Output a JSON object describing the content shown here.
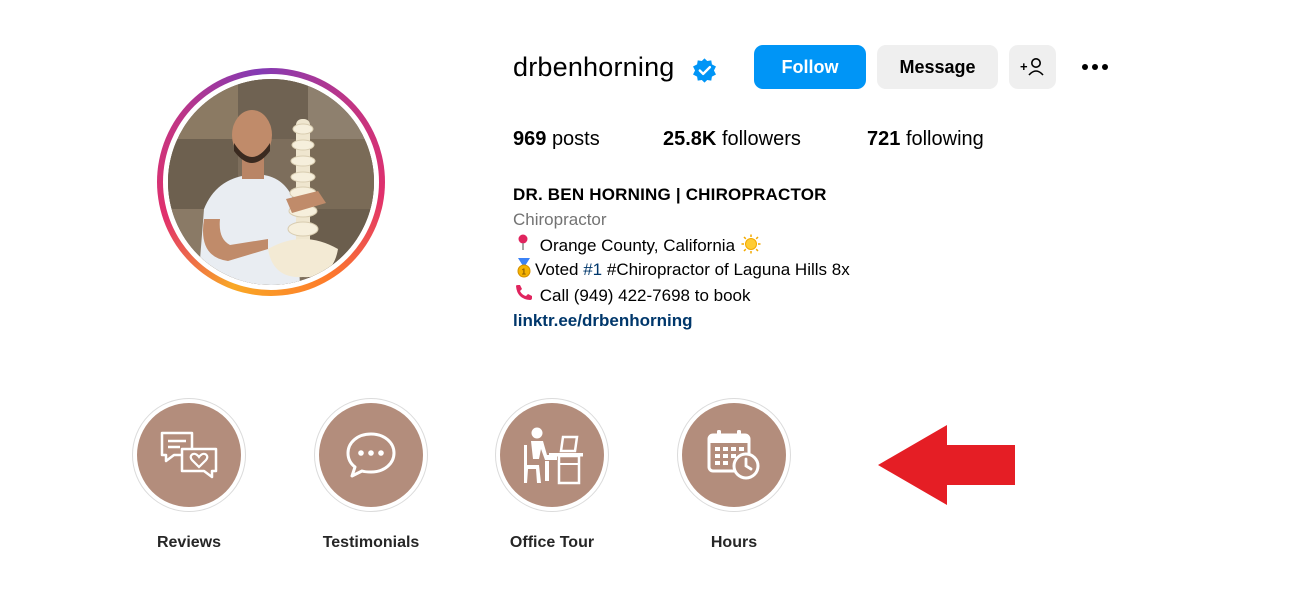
{
  "profile": {
    "username": "drbenhorning",
    "verified": true,
    "follow_label": "Follow",
    "message_label": "Message",
    "stats": {
      "posts_count": "969",
      "posts_label": "posts",
      "followers_count": "25.8K",
      "followers_label": "followers",
      "following_count": "721",
      "following_label": "following"
    },
    "bio": {
      "name": "DR. BEN HORNING | CHIROPRACTOR",
      "category": "Chiropractor",
      "location": "Orange County, California",
      "voted_prefix": "Voted ",
      "voted_hash": "#1",
      "voted_suffix": " #Chiropractor of Laguna Hills 8x",
      "call": "Call (949) 422-7698 to book",
      "link": "linktr.ee/drbenhorning"
    }
  },
  "highlights": [
    {
      "label": "Reviews",
      "icon": "chat-heart-icon"
    },
    {
      "label": "Testimonials",
      "icon": "speech-bubble-icon"
    },
    {
      "label": "Office Tour",
      "icon": "desk-person-icon"
    },
    {
      "label": "Hours",
      "icon": "calendar-clock-icon"
    }
  ],
  "colors": {
    "follow_blue": "#0095f6",
    "highlight_bg": "#b38d7c",
    "arrow_red": "#e51e25",
    "link_blue": "#00376b"
  }
}
